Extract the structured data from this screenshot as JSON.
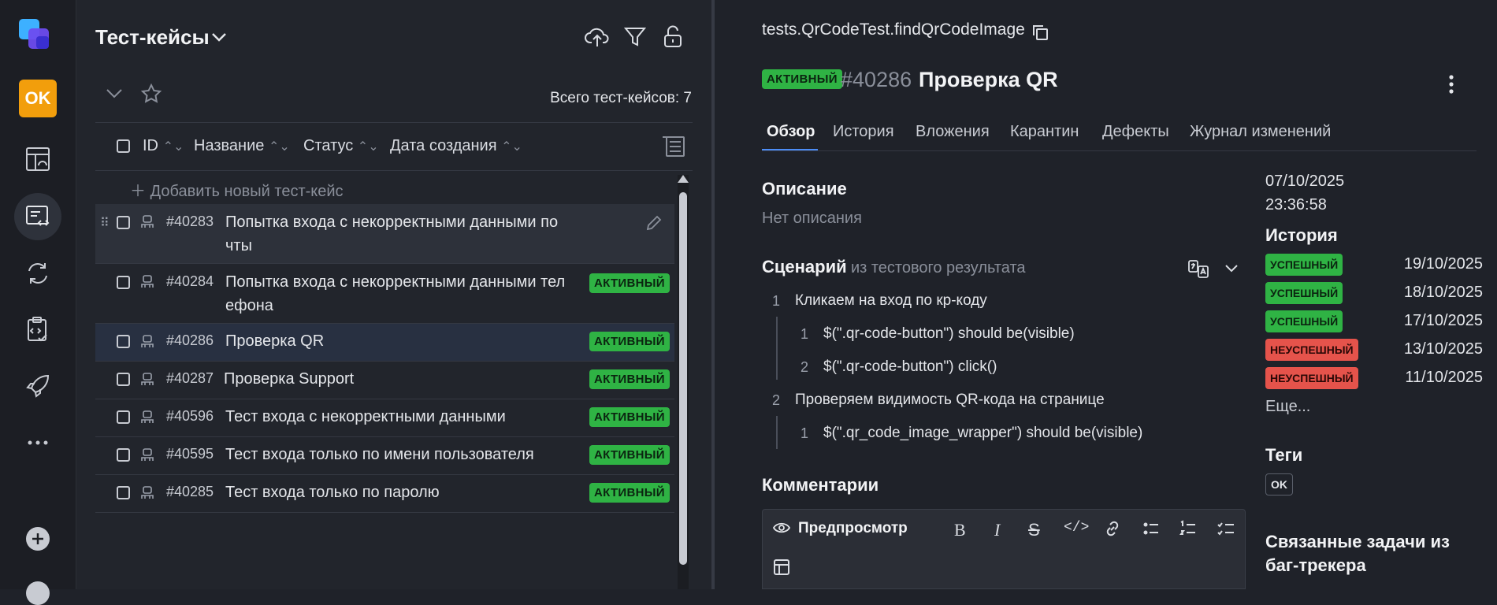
{
  "rail": {
    "user_initials": "OK",
    "items": [
      "dashboard-icon",
      "test-cases-icon",
      "launches-icon",
      "test-plans-icon",
      "deploy-icon",
      "more-icon"
    ],
    "add_icon": "plus-circle-icon"
  },
  "list": {
    "title": "Тест-кейсы",
    "total_label": "Всего тест-кейсов: 7",
    "columns": [
      "ID",
      "Название",
      "Статус",
      "Дата создания"
    ],
    "add_new": "Добавить новый тест-кейс",
    "rows": [
      {
        "id": "#40283",
        "name_line1": "Попытка входа с некорректными данными по",
        "name_line2": "чты",
        "status": ""
      },
      {
        "id": "#40284",
        "name_line1": "Попытка входа с некорректными данными тел",
        "name_line2": "ефона",
        "status": "АКТИВНЫЙ"
      },
      {
        "id": "#40286",
        "name_line1": "Проверка QR",
        "name_line2": "",
        "status": "АКТИВНЫЙ"
      },
      {
        "id": "#40287",
        "name_line1": "Проверка Support",
        "name_line2": "",
        "status": "АКТИВНЫЙ"
      },
      {
        "id": "#40596",
        "name_line1": "Тест входа с некорректными данными",
        "name_line2": "",
        "status": "АКТИВНЫЙ"
      },
      {
        "id": "#40595",
        "name_line1": "Тест входа только по имени пользователя",
        "name_line2": "",
        "status": "АКТИВНЫЙ"
      },
      {
        "id": "#40285",
        "name_line1": "Тест входа только по паролю",
        "name_line2": "",
        "status": "АКТИВНЫЙ"
      }
    ]
  },
  "detail": {
    "path": "tests.QrCodeTest.findQrCodeImage",
    "status": "АКТИВНЫЙ",
    "id": "#40286",
    "name": "Проверка QR",
    "tabs": [
      "Обзор",
      "История",
      "Вложения",
      "Карантин",
      "Дефекты",
      "Журнал изменений"
    ],
    "description_title": "Описание",
    "description_empty": "Нет описания",
    "scenario_title": "Сценарий",
    "scenario_source": "из тестового результата",
    "steps": [
      {
        "num": "1",
        "text": "Кликаем на вход по кр-коду"
      },
      {
        "num": "1",
        "text": "$(\".qr-code-button\") should be(visible)"
      },
      {
        "num": "2",
        "text": "$(\".qr-code-button\") click()"
      },
      {
        "num": "2",
        "text": "Проверяем видимость QR-кода на странице"
      },
      {
        "num": "1",
        "text": "$(\".qr_code_image_wrapper\") should be(visible)"
      }
    ],
    "comments_title": "Комментарии",
    "preview_label": "Предпросмотр",
    "created_date": "07/10/2025",
    "created_time": "23:36:58",
    "history_title": "История",
    "history": [
      {
        "status": "УСПЕШНЫЙ",
        "date": "19/10/2025"
      },
      {
        "status": "УСПЕШНЫЙ",
        "date": "18/10/2025"
      },
      {
        "status": "УСПЕШНЫЙ",
        "date": "17/10/2025"
      },
      {
        "status": "НЕУСПЕШНЫЙ",
        "date": "13/10/2025"
      },
      {
        "status": "НЕУСПЕШНЫЙ",
        "date": "11/10/2025"
      }
    ],
    "more_label": "Еще...",
    "tags_title": "Теги",
    "tags": [
      "OK"
    ],
    "linked_title_line1": "Связанные задачи из",
    "linked_title_line2": "баг-трекера"
  },
  "colors": {
    "accent": "#4c8df6",
    "active": "#2fb344",
    "failed": "#e5534b",
    "user_badge": "#f29e0c"
  }
}
